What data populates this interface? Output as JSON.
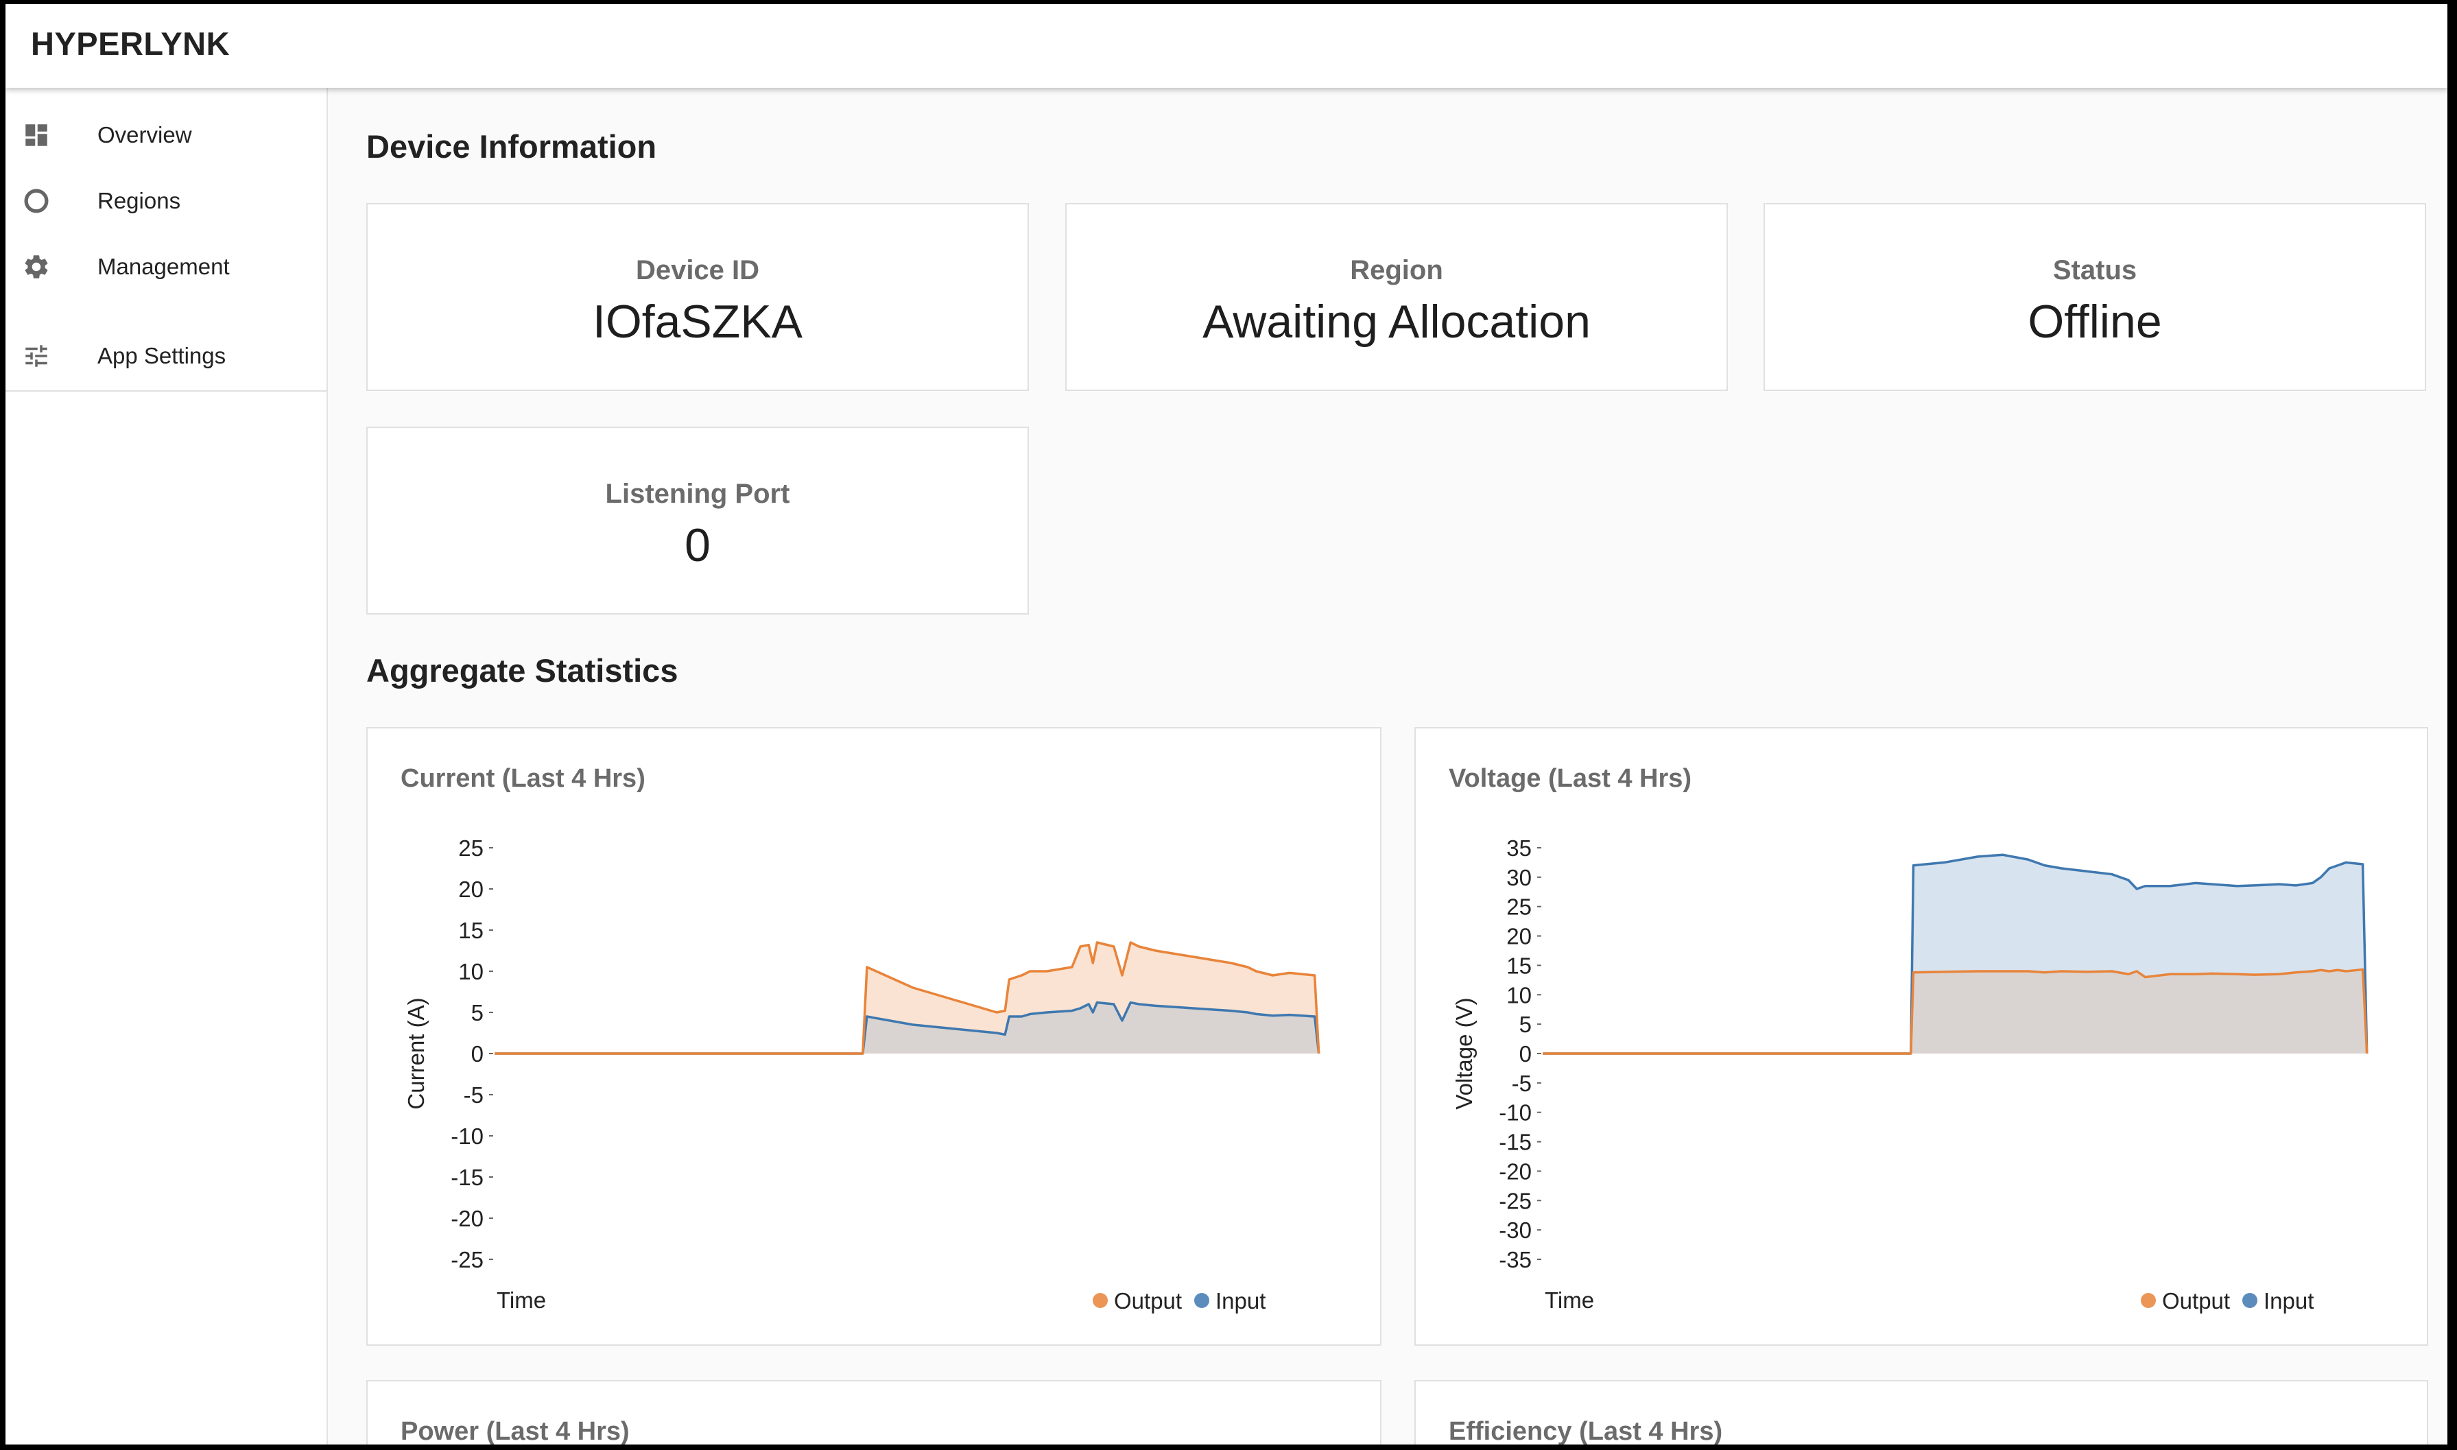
{
  "app": {
    "title": "HYPERLYNK"
  },
  "sidebar": {
    "items": [
      {
        "label": "Overview",
        "icon": "dashboard-icon"
      },
      {
        "label": "Regions",
        "icon": "circle-icon"
      },
      {
        "label": "Management",
        "icon": "gear-icon"
      },
      {
        "label": "App Settings",
        "icon": "sliders-icon"
      }
    ]
  },
  "device_info": {
    "title": "Device Information",
    "cards": [
      {
        "label": "Device ID",
        "value": "IOfaSZKA"
      },
      {
        "label": "Region",
        "value": "Awaiting Allocation"
      },
      {
        "label": "Status",
        "value": "Offline"
      },
      {
        "label": "Listening Port",
        "value": "0"
      }
    ]
  },
  "aggregate": {
    "title": "Aggregate Statistics",
    "more_charts": [
      "Power (Last 4 Hrs)",
      "Efficiency (Last 4 Hrs)"
    ]
  },
  "colors": {
    "output": "#e8843a",
    "input": "#3f78b0",
    "output_fill": "#fae3d2",
    "input_fill": "#d7e3ef",
    "overlap_fill": "#d9d4d1"
  },
  "chart_data": [
    {
      "type": "area",
      "title": "Current (Last 4 Hrs)",
      "xlabel": "Time",
      "ylabel": "Current (A)",
      "ylim": [
        -25,
        25
      ],
      "yticks": [
        25,
        20,
        15,
        10,
        5,
        0,
        -5,
        -10,
        -15,
        -20,
        -25
      ],
      "legend": "bottom-right",
      "x": [
        0,
        44,
        44.5,
        50,
        55,
        60,
        61,
        61.5,
        63,
        64,
        66,
        69,
        70,
        71,
        71.5,
        72,
        74,
        75,
        76,
        77,
        79,
        82,
        85,
        88,
        90,
        91,
        93,
        95,
        98,
        98.5
      ],
      "series": [
        {
          "name": "Output",
          "values": [
            0,
            0,
            10.5,
            8.0,
            6.5,
            5.0,
            5.2,
            9.0,
            9.5,
            10.0,
            10.0,
            10.5,
            13.0,
            13.2,
            11.0,
            13.5,
            13.0,
            9.5,
            13.5,
            13.0,
            12.5,
            12.0,
            11.5,
            11.0,
            10.5,
            10.0,
            9.5,
            9.8,
            9.5,
            0
          ]
        },
        {
          "name": "Input",
          "values": [
            0,
            0,
            4.5,
            3.5,
            3.0,
            2.5,
            2.3,
            4.5,
            4.5,
            4.8,
            5.0,
            5.2,
            5.5,
            6.0,
            5.0,
            6.2,
            6.0,
            4.0,
            6.2,
            6.0,
            5.8,
            5.6,
            5.4,
            5.2,
            5.0,
            4.8,
            4.6,
            4.7,
            4.5,
            0
          ]
        }
      ]
    },
    {
      "type": "area",
      "title": "Voltage (Last 4 Hrs)",
      "xlabel": "Time",
      "ylabel": "Voltage (V)",
      "ylim": [
        -35,
        35
      ],
      "yticks": [
        35,
        30,
        25,
        20,
        15,
        10,
        5,
        0,
        -5,
        -10,
        -15,
        -20,
        -25,
        -30,
        -35
      ],
      "legend": "bottom-right",
      "x": [
        0,
        44,
        44.3,
        48,
        52,
        55,
        58,
        60,
        62,
        65,
        68,
        70,
        71,
        72,
        75,
        78,
        80,
        83,
        85,
        88,
        90,
        92,
        93,
        94,
        95,
        96,
        98,
        98.5
      ],
      "series": [
        {
          "name": "Output",
          "values": [
            0,
            0,
            13.8,
            13.9,
            14.0,
            14.0,
            14.0,
            13.8,
            14.0,
            13.9,
            14.0,
            13.5,
            14.0,
            13.0,
            13.5,
            13.5,
            13.6,
            13.5,
            13.4,
            13.5,
            13.8,
            14.0,
            14.2,
            14.0,
            14.2,
            14.0,
            14.3,
            0
          ]
        },
        {
          "name": "Input",
          "values": [
            0,
            0,
            32.0,
            32.5,
            33.5,
            33.8,
            33.0,
            32.0,
            31.5,
            31.0,
            30.5,
            29.5,
            28.0,
            28.5,
            28.5,
            29.0,
            28.8,
            28.5,
            28.6,
            28.8,
            28.6,
            29.0,
            30.0,
            31.5,
            32.0,
            32.5,
            32.2,
            0
          ]
        }
      ]
    }
  ]
}
